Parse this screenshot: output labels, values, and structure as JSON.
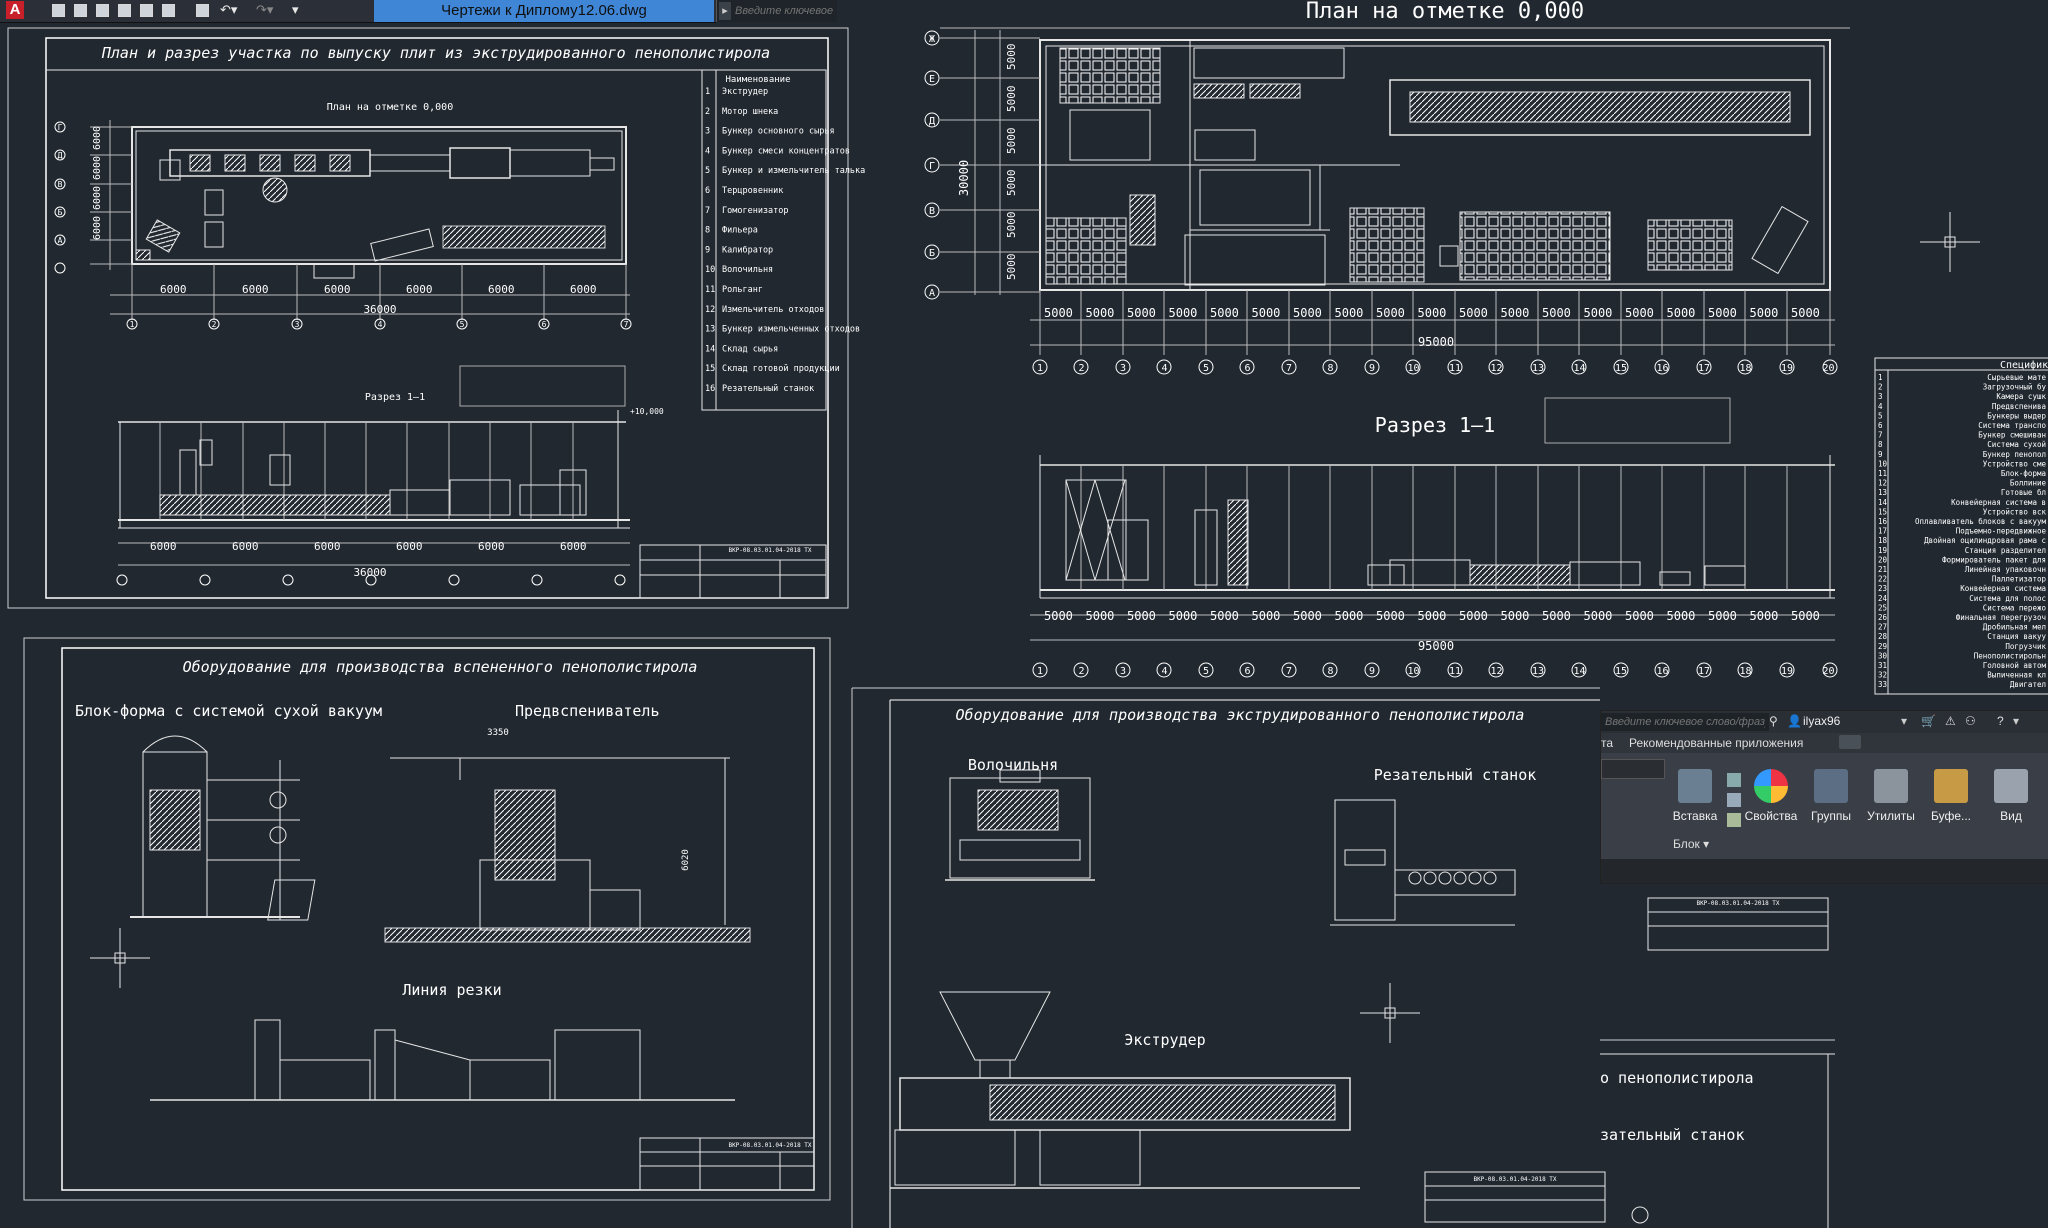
{
  "app": {
    "logo_letter": "A",
    "file_title": "Чертежи к Диплому12.06.dwg",
    "search_placeholder": "Введите ключевое с"
  },
  "drawings": {
    "sheet1": {
      "title": "План и разрез участка по выпуску плит из экструдированного пенополистирола",
      "plan_caption": "План на отметке 0,000",
      "section_caption": "Разрез 1–1",
      "axis_letters": [
        "Г",
        "Д",
        "В",
        "Б",
        "А"
      ],
      "axis_numbers": [
        "1",
        "2",
        "3",
        "4",
        "5",
        "6",
        "7"
      ],
      "spans": [
        "6000",
        "6000",
        "6000",
        "6000",
        "6000",
        "6000"
      ],
      "total": "36000",
      "dim_side": [
        "6000",
        "6000",
        "6000",
        "6000"
      ],
      "elevation": "+10,000",
      "stamp_code": "ВКР-08.03.01.04-2018 ТХ",
      "spec_header": "Наименование",
      "spec": [
        {
          "n": "1",
          "name": "Экструдер"
        },
        {
          "n": "2",
          "name": "Мотор шнека"
        },
        {
          "n": "3",
          "name": "Бункер основного сырья"
        },
        {
          "n": "4",
          "name": "Бункер смеси концентратов"
        },
        {
          "n": "5",
          "name": "Бункер и измельчитель талька"
        },
        {
          "n": "6",
          "name": "Терцровенник"
        },
        {
          "n": "7",
          "name": "Гомогенизатор"
        },
        {
          "n": "8",
          "name": "Фильера"
        },
        {
          "n": "9",
          "name": "Калибратор"
        },
        {
          "n": "10",
          "name": "Волочильня"
        },
        {
          "n": "11",
          "name": "Рольганг"
        },
        {
          "n": "12",
          "name": "Измельчитель отходов"
        },
        {
          "n": "13",
          "name": "Бункер измельченных отходов"
        },
        {
          "n": "14",
          "name": "Склад сырья"
        },
        {
          "n": "15",
          "name": "Склад готовой продукции"
        },
        {
          "n": "16",
          "name": "Резательный станок"
        }
      ]
    },
    "sheet2": {
      "plan_caption": "План на отметке 0,000",
      "section_caption": "Разрез 1–1",
      "axis_letters": [
        "Ж",
        "Е",
        "Д",
        "Г",
        "В",
        "Б",
        "А"
      ],
      "axis_numbers": [
        "1",
        "2",
        "3",
        "4",
        "5",
        "6",
        "7",
        "8",
        "9",
        "10",
        "11",
        "12",
        "13",
        "14",
        "15",
        "16",
        "17",
        "18",
        "19",
        "20"
      ],
      "span": "5000",
      "total": "95000",
      "height": "30000",
      "spec_title": "Спецификац",
      "spec": [
        "Сырьевые мате",
        "Загрузочный бу",
        "Камера сушк",
        "Предвспенива",
        "Бункеры выдер",
        "Система транспо",
        "Бункер смешиван",
        "Система сухой",
        "Бункер пенопол",
        "Устройство сме",
        "Блок-форма",
        "Боллиние",
        "Готовые бл",
        "Конвейерная система в",
        "Устройство вск",
        "Оплавливатель блоков с вакуум",
        "Подъемно-передвижное",
        "Двойная оцилиндровая рама с",
        "Станция разделител",
        "Формирователь пакет для",
        "Линейная упаковочн",
        "Паллетизатор",
        "Конвейерная система",
        "Система для полос",
        "Система пережо",
        "Финальная перегрузоч",
        "Дробильная мел",
        "Станция вакуу",
        "Погрузчик",
        "Пенополистирольн",
        "Головной автом",
        "Выпиченная кл",
        "Двигател"
      ]
    },
    "sheet3": {
      "title": "Оборудование для производства вспененного пенополистирола",
      "sub1": "Блок-форма с системой сухой вакуум",
      "sub2": "Предвспениватель",
      "sub3": "Линия резки",
      "dim1": "3350",
      "dim2": "6020",
      "stamp_code": "ВКР-08.03.01.04-2018 ТХ"
    },
    "sheet4": {
      "title": "Оборудование для производства экструдированного пенополистирола",
      "sub1": "Волочильня",
      "sub2": "Резательный станок",
      "sub3": "Экструдер",
      "stamp_code": "ВКР-08.03.01.04-2018 ТХ"
    },
    "sheet5": {
      "title_fragment": "о пенополистирола",
      "sub_fragment": "зательный станок",
      "stamp_code": "ВКР-08.03.01.04-2018 ТХ"
    }
  },
  "ribbon": {
    "search_placeholder": "Введите ключевое слово/фразу",
    "user": "ilyax96",
    "tab_label": "Рекомендованные приложения",
    "panel_label": "Блок",
    "buttons": [
      {
        "label": "Вставка",
        "color": "#6a7f92"
      },
      {
        "label": "Свойства",
        "color": "#e6a23c"
      },
      {
        "label": "Группы",
        "color": "#5b6e84"
      },
      {
        "label": "Утилиты",
        "color": "#8b939c"
      },
      {
        "label": "Буфе...",
        "color": "#c79a45"
      },
      {
        "label": "Вид",
        "color": "#9aa3ad"
      }
    ]
  }
}
